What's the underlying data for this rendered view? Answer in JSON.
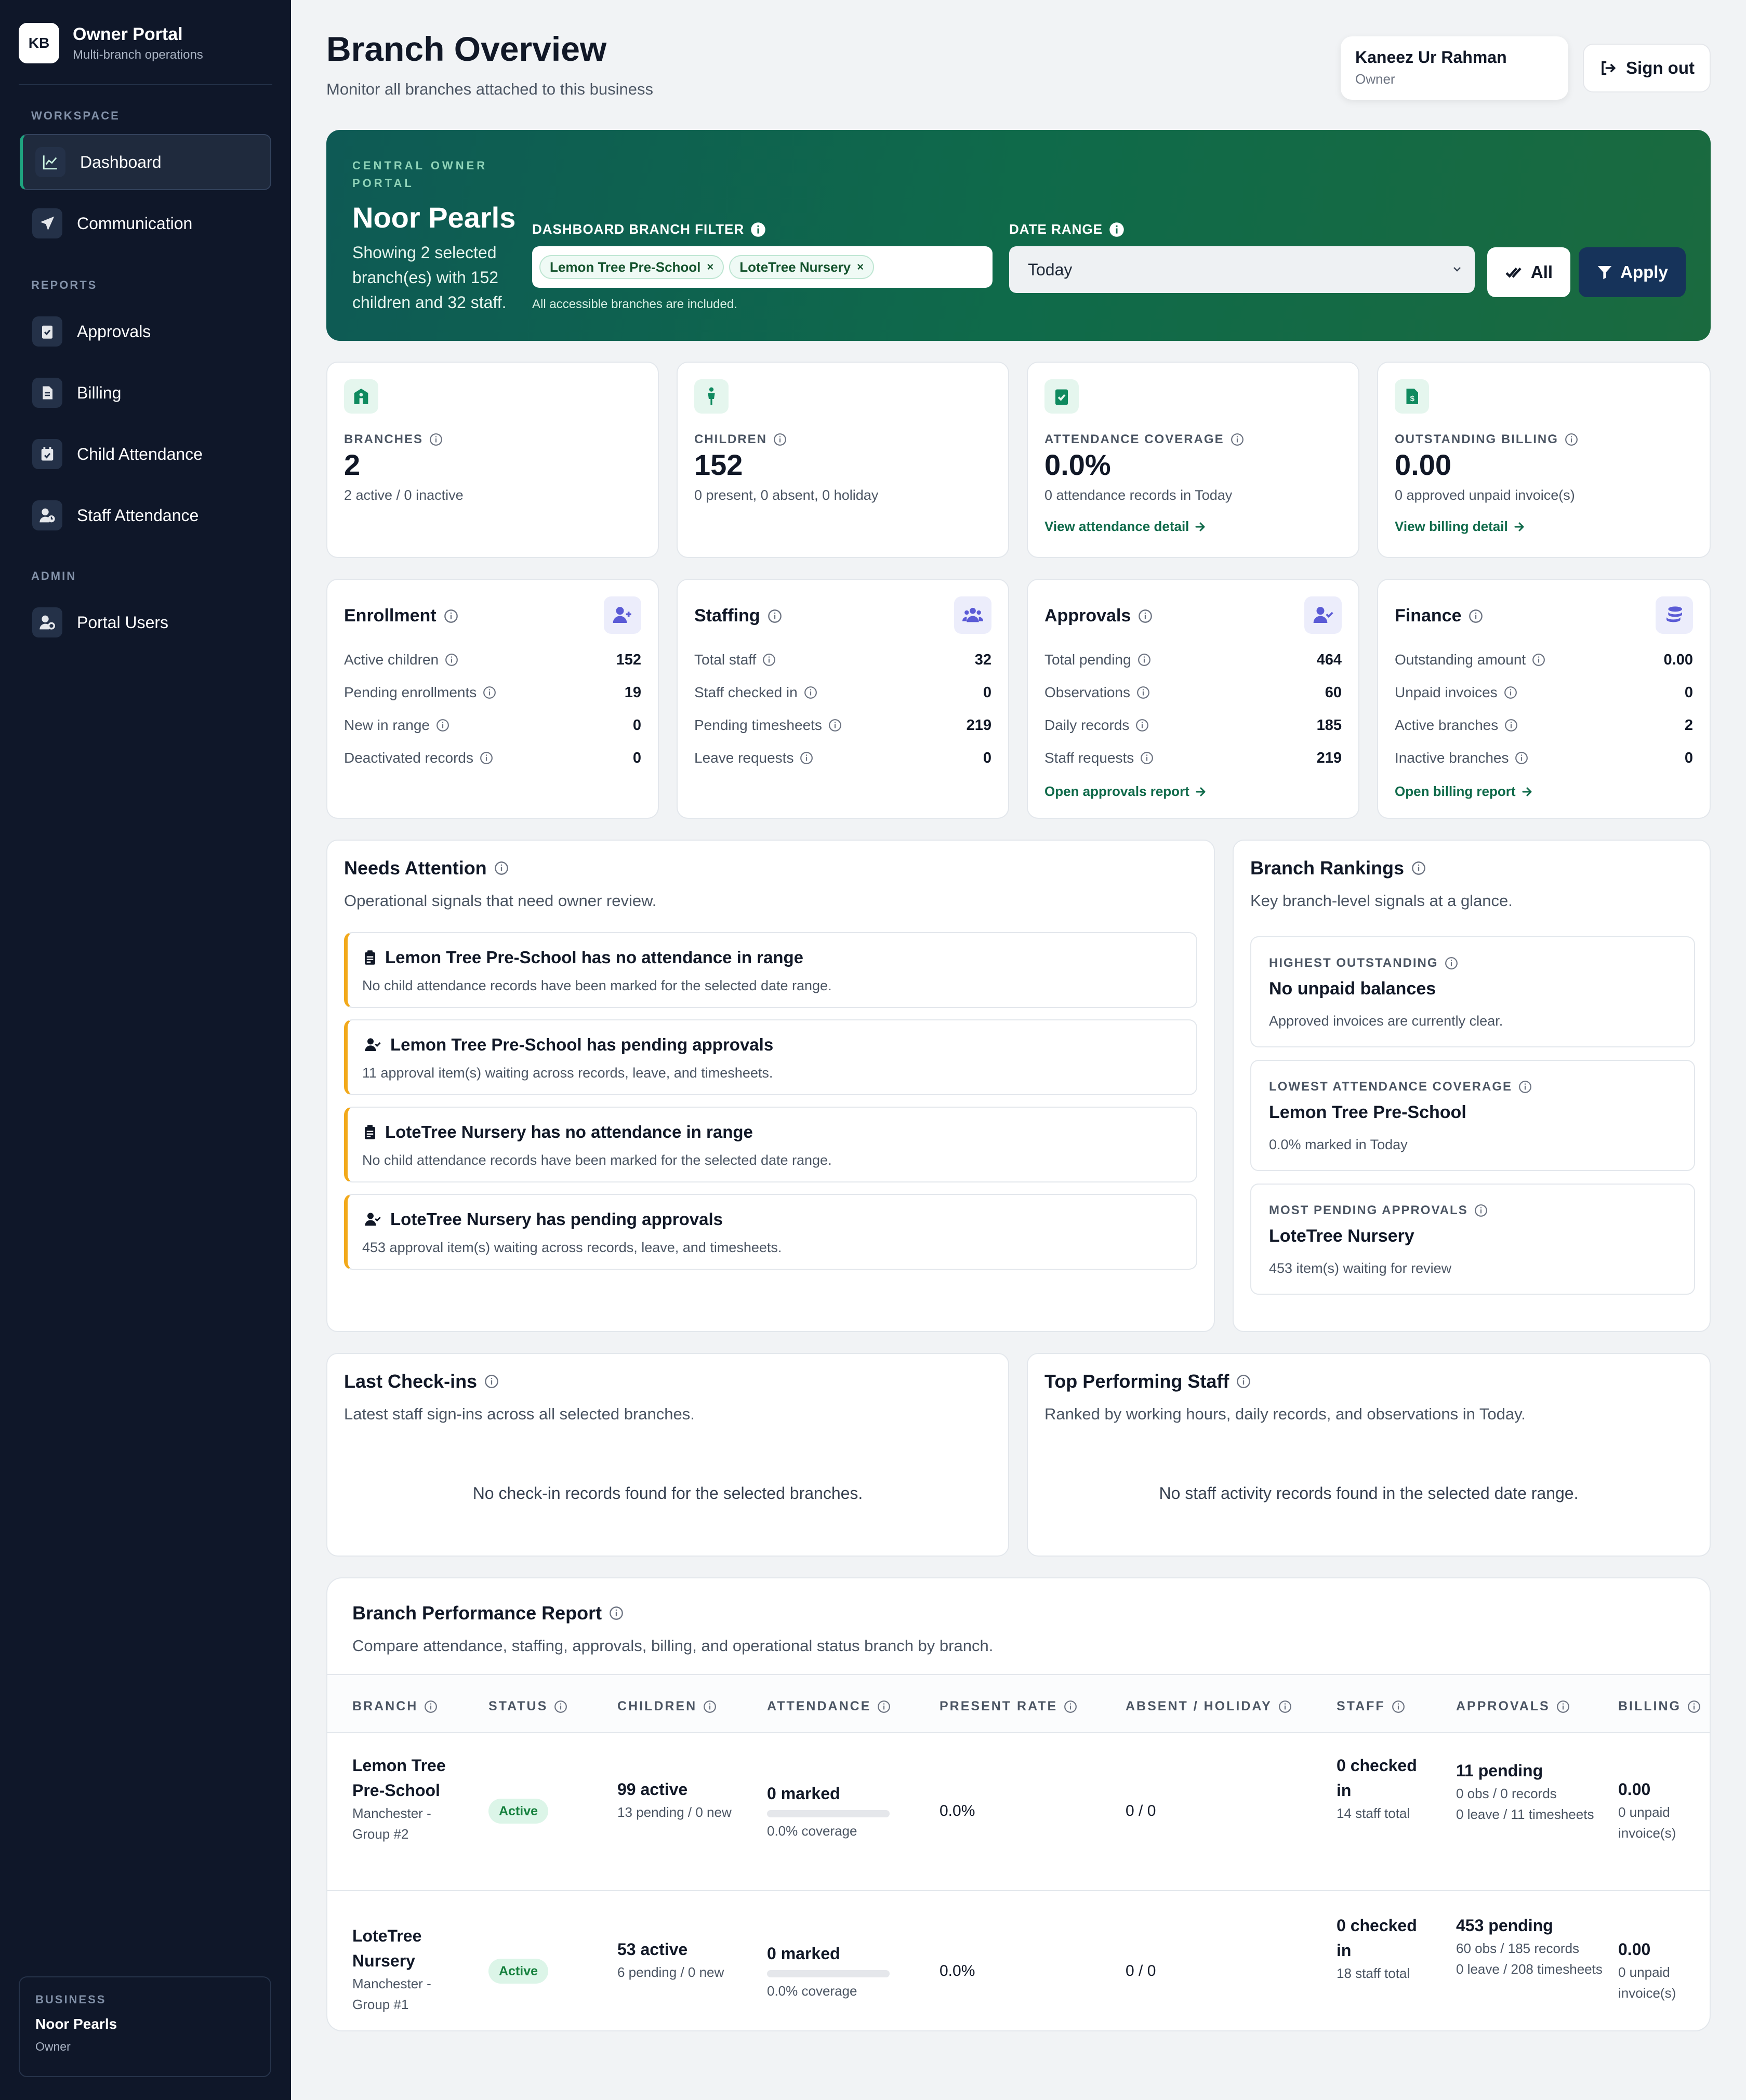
{
  "sidebar": {
    "logo": "KB",
    "title": "Owner Portal",
    "subtitle": "Multi-branch operations",
    "sections": {
      "workspace": "WORKSPACE",
      "reports": "REPORTS",
      "admin": "ADMIN"
    },
    "items": {
      "dashboard": "Dashboard",
      "communication": "Communication",
      "approvals": "Approvals",
      "billing": "Billing",
      "child_attendance": "Child Attendance",
      "staff_attendance": "Staff Attendance",
      "portal_users": "Portal Users"
    },
    "active_item": "Dashboard",
    "business": {
      "label": "BUSINESS",
      "name": "Noor Pearls",
      "role": "Owner"
    }
  },
  "header": {
    "title": "Branch Overview",
    "subtitle": "Monitor all branches attached to this business",
    "user_name": "Kaneez Ur Rahman",
    "user_role": "Owner",
    "signout": "Sign out"
  },
  "hero": {
    "kicker": "CENTRAL OWNER PORTAL",
    "business": "Noor Pearls",
    "description": "Showing 2 selected branch(es) with 152 children and 32 staff.",
    "filter_label": "DASHBOARD BRANCH FILTER",
    "chips": [
      "Lemon Tree Pre-School",
      "LoteTree Nursery"
    ],
    "chip_remove": "×",
    "filter_hint": "All accessible branches are included.",
    "date_label": "DATE RANGE",
    "date_value": "Today",
    "all_button": "All",
    "apply_button": "Apply"
  },
  "stats": {
    "branches": {
      "label": "BRANCHES",
      "value": "2",
      "sub": "2 active / 0 inactive"
    },
    "children": {
      "label": "CHILDREN",
      "value": "152",
      "sub": "0 present, 0 absent, 0 holiday"
    },
    "attendance": {
      "label": "ATTENDANCE COVERAGE",
      "value": "0.0%",
      "sub": "0 attendance records in Today",
      "link": "View attendance detail"
    },
    "billing": {
      "label": "OUTSTANDING BILLING",
      "value": "0.00",
      "sub": "0 approved unpaid invoice(s)",
      "link": "View billing detail"
    }
  },
  "details": {
    "enrollment": {
      "title": "Enrollment",
      "rows": [
        {
          "k": "Active children",
          "v": "152"
        },
        {
          "k": "Pending enrollments",
          "v": "19"
        },
        {
          "k": "New in range",
          "v": "0"
        },
        {
          "k": "Deactivated records",
          "v": "0"
        }
      ]
    },
    "staffing": {
      "title": "Staffing",
      "rows": [
        {
          "k": "Total staff",
          "v": "32"
        },
        {
          "k": "Staff checked in",
          "v": "0"
        },
        {
          "k": "Pending timesheets",
          "v": "219"
        },
        {
          "k": "Leave requests",
          "v": "0"
        }
      ]
    },
    "approvals": {
      "title": "Approvals",
      "link": "Open approvals report",
      "rows": [
        {
          "k": "Total pending",
          "v": "464"
        },
        {
          "k": "Observations",
          "v": "60"
        },
        {
          "k": "Daily records",
          "v": "185"
        },
        {
          "k": "Staff requests",
          "v": "219"
        }
      ]
    },
    "finance": {
      "title": "Finance",
      "link": "Open billing report",
      "rows": [
        {
          "k": "Outstanding amount",
          "v": "0.00"
        },
        {
          "k": "Unpaid invoices",
          "v": "0"
        },
        {
          "k": "Active branches",
          "v": "2"
        },
        {
          "k": "Inactive branches",
          "v": "0"
        }
      ]
    }
  },
  "attention": {
    "title": "Needs Attention",
    "subtitle": "Operational signals that need owner review.",
    "items": [
      {
        "title": "Lemon Tree Pre-School has no attendance in range",
        "sub": "No child attendance records have been marked for the selected date range.",
        "icon": "clipboard-icon"
      },
      {
        "title": "Lemon Tree Pre-School has pending approvals",
        "sub": "11 approval item(s) waiting across records, leave, and timesheets.",
        "icon": "user-check-icon"
      },
      {
        "title": "LoteTree Nursery has no attendance in range",
        "sub": "No child attendance records have been marked for the selected date range.",
        "icon": "clipboard-icon"
      },
      {
        "title": "LoteTree Nursery has pending approvals",
        "sub": "453 approval item(s) waiting across records, leave, and timesheets.",
        "icon": "user-check-icon"
      }
    ]
  },
  "rankings": {
    "title": "Branch Rankings",
    "subtitle": "Key branch-level signals at a glance.",
    "items": [
      {
        "label": "HIGHEST OUTSTANDING",
        "value": "No unpaid balances",
        "sub": "Approved invoices are currently clear."
      },
      {
        "label": "LOWEST ATTENDANCE COVERAGE",
        "value": "Lemon Tree Pre-School",
        "sub": "0.0% marked in Today"
      },
      {
        "label": "MOST PENDING APPROVALS",
        "value": "LoteTree Nursery",
        "sub": "453 item(s) waiting for review"
      }
    ]
  },
  "checkins": {
    "title": "Last Check-ins",
    "subtitle": "Latest staff sign-ins across all selected branches.",
    "empty": "No check-in records found for the selected branches."
  },
  "top_staff": {
    "title": "Top Performing Staff",
    "subtitle": "Ranked by working hours, daily records, and observations in Today.",
    "empty": "No staff activity records found in the selected date range."
  },
  "report": {
    "title": "Branch Performance Report",
    "subtitle": "Compare attendance, staffing, approvals, billing, and operational status branch by branch.",
    "columns": [
      "BRANCH",
      "STATUS",
      "CHILDREN",
      "ATTENDANCE",
      "PRESENT RATE",
      "ABSENT / HOLIDAY",
      "STAFF",
      "APPROVALS",
      "BILLING"
    ],
    "rows": [
      {
        "branch": "Lemon Tree Pre-School",
        "group": "Manchester - Group #2",
        "status": "Active",
        "children": "99 active",
        "children_sub": "13 pending / 0 new",
        "attendance": "0 marked",
        "coverage": "0.0% coverage",
        "coverage_fraction": 0,
        "present_rate": "0.0%",
        "absent_holiday": "0 / 0",
        "staff": "0 checked in",
        "staff_sub": "14 staff total",
        "approvals": "11 pending",
        "approvals_sub1": "0 obs / 0 records",
        "approvals_sub2": "0 leave / 11 timesheets",
        "billing": "0.00",
        "billing_sub": "0 unpaid invoice(s)"
      },
      {
        "branch": "LoteTree Nursery",
        "group": "Manchester - Group #1",
        "status": "Active",
        "children": "53 active",
        "children_sub": "6 pending / 0 new",
        "attendance": "0 marked",
        "coverage": "0.0% coverage",
        "coverage_fraction": 0,
        "present_rate": "0.0%",
        "absent_holiday": "0 / 0",
        "staff": "0 checked in",
        "staff_sub": "18 staff total",
        "approvals": "453 pending",
        "approvals_sub1": "60 obs / 185 records",
        "approvals_sub2": "0 leave / 208 timesheets",
        "billing": "0.00",
        "billing_sub": "0 unpaid invoice(s)"
      }
    ]
  },
  "colors": {
    "sidebar": "#0f1729",
    "accent": "#0f6a4a",
    "warning": "#f2a91b",
    "apply": "#16335a"
  }
}
